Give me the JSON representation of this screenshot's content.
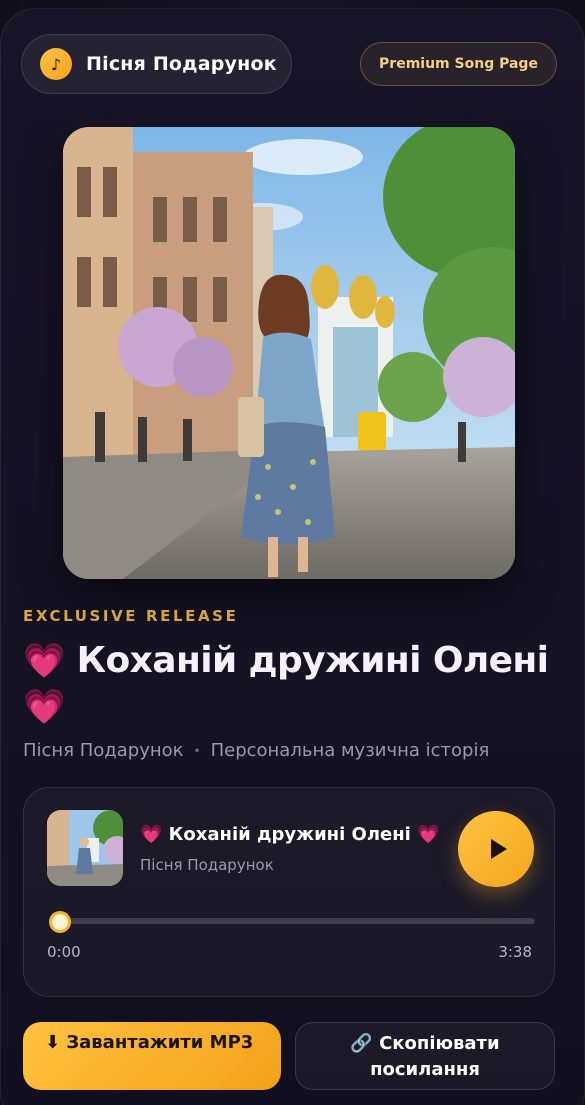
{
  "header": {
    "brand_icon": "♪",
    "brand_name": "Пісня Подарунок",
    "badge": "Premium Song Page"
  },
  "cover": {
    "icon": "cover-art-image",
    "description_colors": {
      "sky": "#9cc7ea",
      "accent": "#f5b42c"
    }
  },
  "release": {
    "eyebrow": "EXCLUSIVE RELEASE",
    "heart_start": "💗",
    "title": "Коханій дружині Олені",
    "heart_end": "💗",
    "artist": "Пісня Подарунок",
    "separator": "•",
    "subtitle": "Персональна музична історія"
  },
  "player": {
    "track_title": "💗 Коханій дружині Олені 💗",
    "track_artist": "Пісня Подарунок",
    "current_time": "0:00",
    "total_time": "3:38",
    "progress": 0
  },
  "actions": {
    "download_label": "⬇ Завантажити MP3",
    "copy_label": "🔗 Скопіювати посилання"
  },
  "colors": {
    "accent": "#f5b42c",
    "background": "#151224",
    "eyebrow": "#d8a640"
  }
}
